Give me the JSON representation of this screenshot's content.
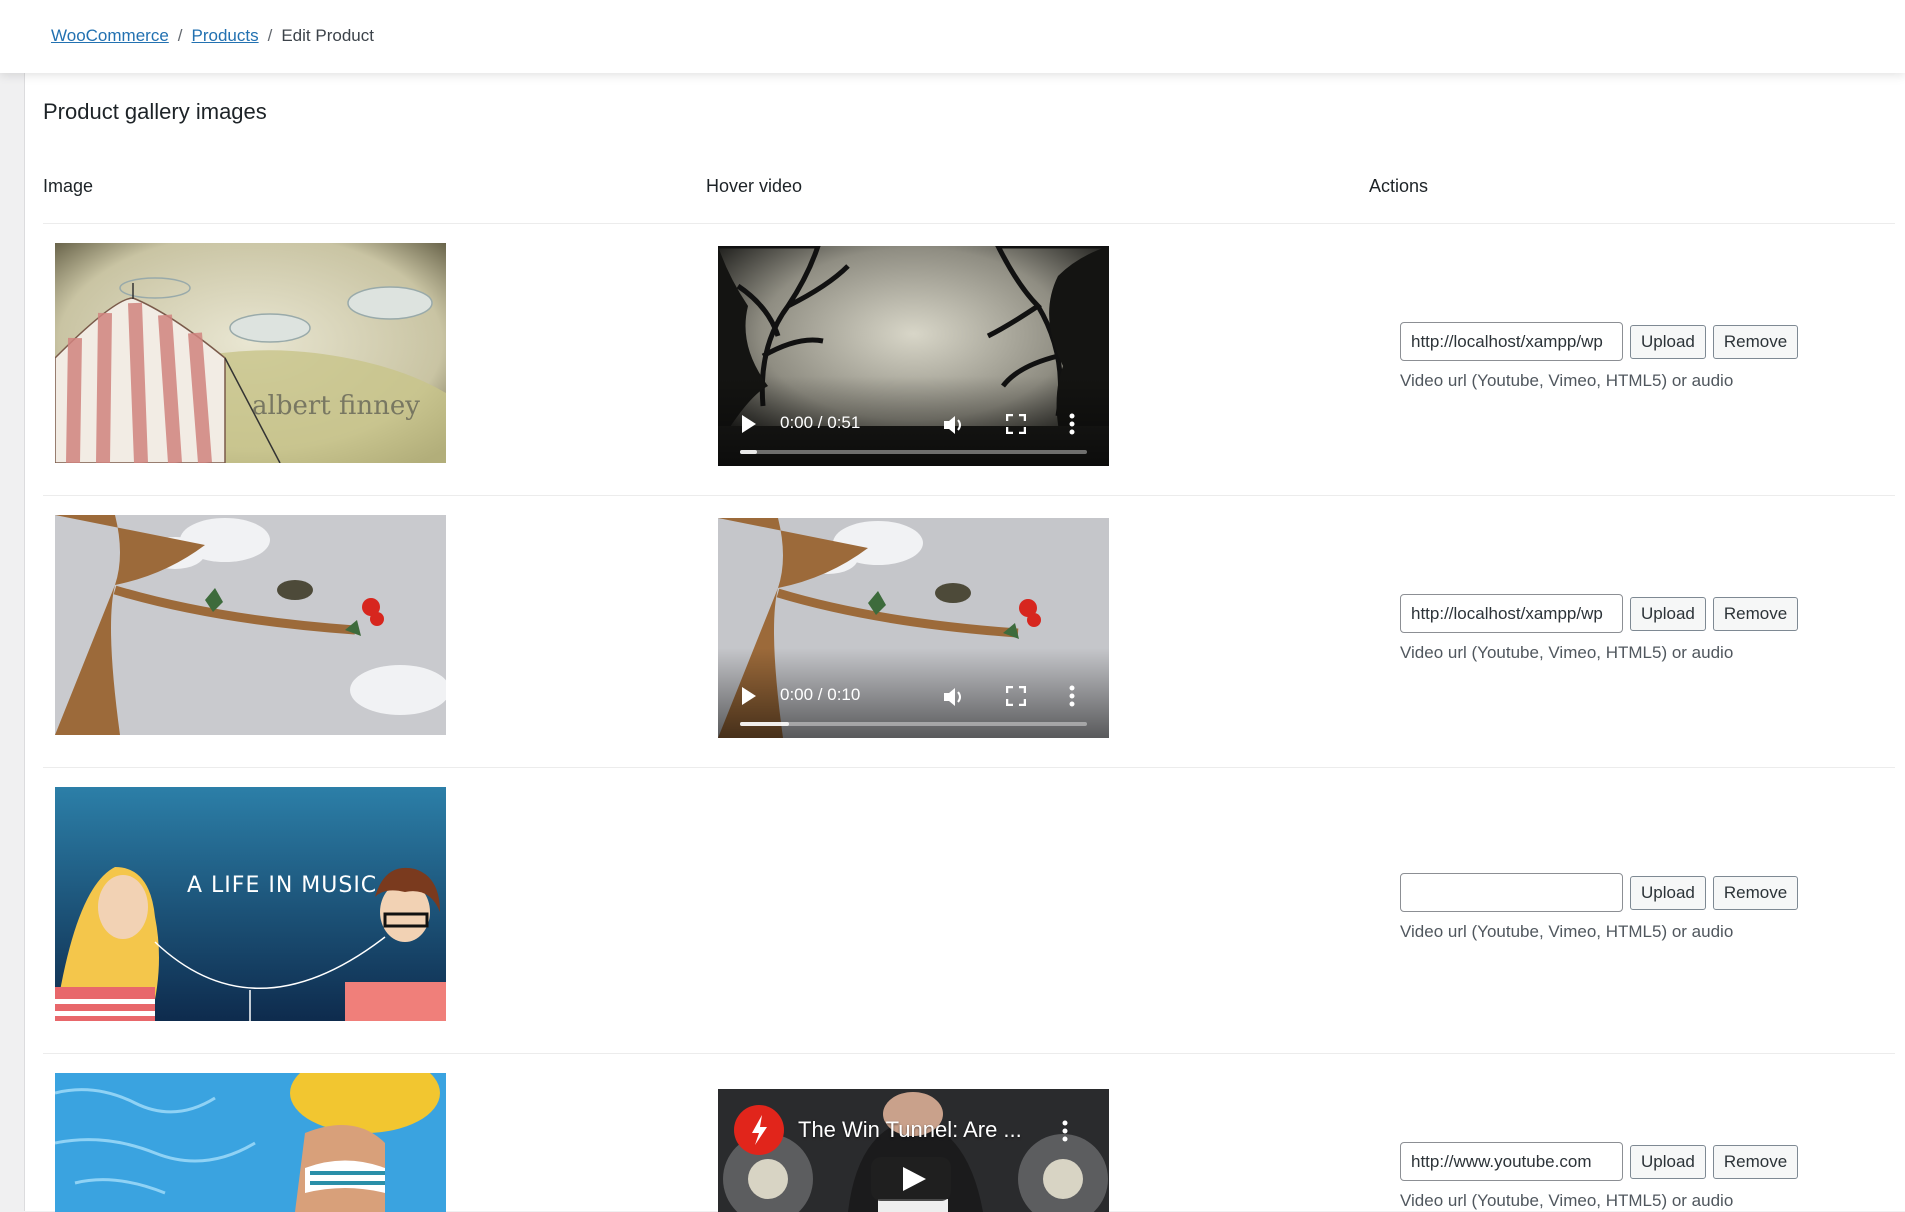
{
  "breadcrumb": {
    "items": [
      "WooCommerce",
      "Products"
    ],
    "current": "Edit Product",
    "separator": "/"
  },
  "section": {
    "title": "Product gallery images",
    "columns": {
      "image": "Image",
      "video": "Hover video",
      "actions": "Actions"
    }
  },
  "rows": [
    {
      "image_text": "albert finney",
      "video": {
        "type": "html5",
        "time": "0:00 / 0:51",
        "progress": 0.05
      },
      "url_value": "http://localhost/xampp/wp",
      "upload_label": "Upload",
      "remove_label": "Remove",
      "hint": "Video url (Youtube, Vimeo, HTML5) or audio"
    },
    {
      "image_text": "",
      "video": {
        "type": "html5",
        "time": "0:00 / 0:10",
        "progress": 0.14
      },
      "url_value": "http://localhost/xampp/wp",
      "upload_label": "Upload",
      "remove_label": "Remove",
      "hint": "Video url (Youtube, Vimeo, HTML5) or audio"
    },
    {
      "image_text": "A LIFE IN MUSIC",
      "video": null,
      "url_value": "",
      "upload_label": "Upload",
      "remove_label": "Remove",
      "hint": "Video url (Youtube, Vimeo, HTML5) or audio"
    },
    {
      "image_text": "",
      "video": {
        "type": "youtube",
        "title": "The Win Tunnel: Are ..."
      },
      "url_value": "http://www.youtube.com",
      "upload_label": "Upload",
      "remove_label": "Remove",
      "hint": "Video url (Youtube, Vimeo, HTML5) or audio"
    }
  ],
  "colors": {
    "link": "#2271b1",
    "accent_red": "#e1251b"
  }
}
